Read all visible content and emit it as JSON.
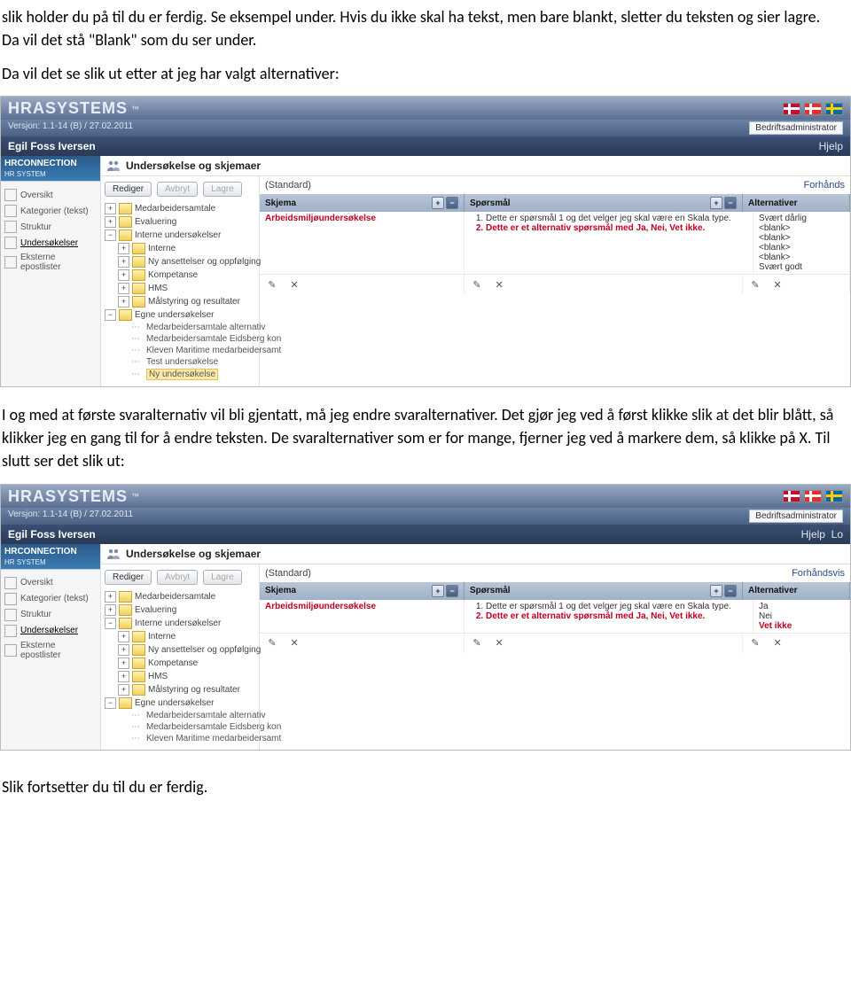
{
  "doc": {
    "p1": "slik holder du på til du er ferdig. Se eksempel under. Hvis du ikke skal ha tekst, men bare blankt, sletter du teksten og sier lagre. Da vil det stå \"Blank\" som du ser under.",
    "p2": "Da vil det se slik ut etter at jeg har valgt alternativer:",
    "p3": "I og med at første svaralternativ vil bli gjentatt, må jeg endre svaralternativer. Det gjør jeg ved å først klikke slik at det blir blått, så klikker jeg en gang til for å endre teksten. De svaralternativer som er for mange, fjerner jeg ved å markere dem, så klikke på X. Til slutt ser det slik ut:",
    "p4": "Slik fortsetter du til du er ferdig."
  },
  "app": {
    "brand": "HRASYSTEMS",
    "brand_tm": "™",
    "version_line": "Versjon: 1.1-14 (B) / 27.02.2011",
    "admin_label": "Bedriftsadministrator",
    "user": "Egil Foss Iversen",
    "hjelp": "Hjelp",
    "logout": "Lo",
    "hrconn": "HRCONNECTION",
    "hrconn_sub": "HR SYSTEM",
    "section_title": "Undersøkelse og skjemaer",
    "sidemenu": {
      "oversikt": "Oversikt",
      "kategorier": "Kategorier (tekst)",
      "struktur": "Struktur",
      "undersok": "Undersøkelser",
      "epost": "Eksterne epostlister"
    },
    "buttons": {
      "rediger": "Rediger",
      "avbryt": "Avbryt",
      "lagre": "Lagre"
    },
    "tree": {
      "n1": "Medarbeidersamtale",
      "n2": "Evaluering",
      "n3": "Interne undersøkelser",
      "n3a": "Interne",
      "n3b": "Ny ansettelser og oppfølging",
      "n3c": "Kompetanse",
      "n3d": "HMS",
      "n3e": "Målstyring og resultater",
      "n4": "Egne undersøkelser",
      "l1": "Medarbeidersamtale alternativ",
      "l2": "Medarbeidersamtale Eidsberg kon",
      "l3": "Kleven Maritime medarbeidersamt",
      "l4": "Test undersøkelse",
      "l5": "Ny undersøkelse"
    },
    "standard": "(Standard)",
    "preview1": "Forhånds",
    "preview2": "Forhåndsvis",
    "cols": {
      "skjema": "Skjema",
      "sporsmal": "Spørsmål",
      "alternativer": "Alternativer"
    },
    "skjema_val": "Arbeidsmiljøundersøkelse",
    "sporsmal": {
      "q1": "Dette er spørsmål 1 og det velger jeg skal være en Skala type.",
      "q2": "Dette er et alternativ spørsmål med Ja, Nei, Vet ikke."
    },
    "alts1": {
      "a1": "Svært dårlig",
      "a2": "<blank>",
      "a3": "<blank>",
      "a4": "<blank>",
      "a5": "<blank>",
      "a6": "Svært godt"
    },
    "alts2": {
      "a1": "Ja",
      "a2": "Nei",
      "a3": "Vet ikke"
    }
  }
}
